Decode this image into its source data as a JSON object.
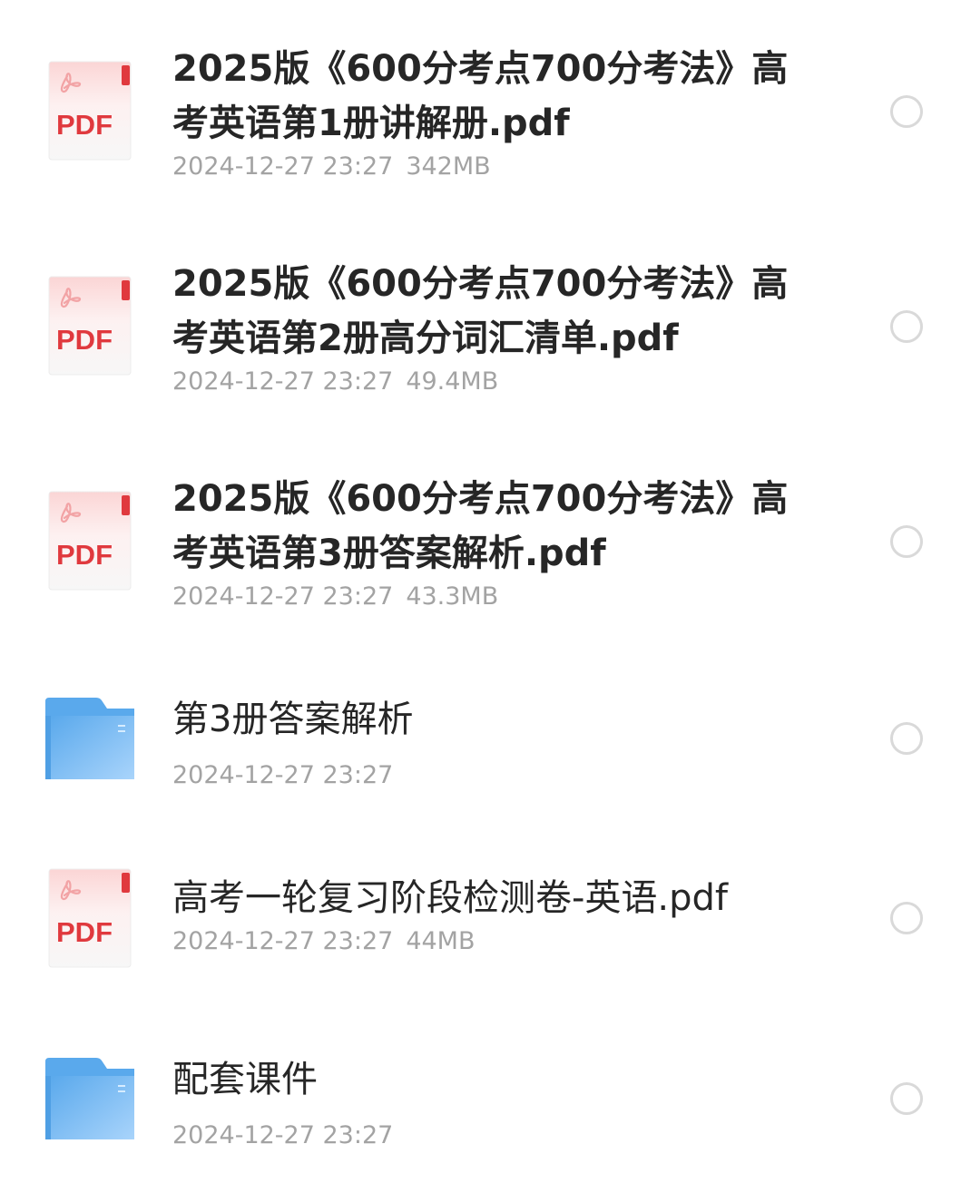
{
  "files": [
    {
      "type": "pdf",
      "icon": "pdf-icon",
      "icon_label": "PDF",
      "name": "2025版《600分考点700分考法》高考英语第1册讲解册.pdf",
      "date": "2024-12-27 23:27",
      "size": "342MB"
    },
    {
      "type": "pdf",
      "icon": "pdf-icon",
      "icon_label": "PDF",
      "name": "2025版《600分考点700分考法》高考英语第2册高分词汇清单.pdf",
      "date": "2024-12-27 23:27",
      "size": "49.4MB"
    },
    {
      "type": "pdf",
      "icon": "pdf-icon",
      "icon_label": "PDF",
      "name": "2025版《600分考点700分考法》高考英语第3册答案解析.pdf",
      "date": "2024-12-27 23:27",
      "size": "43.3MB"
    },
    {
      "type": "folder",
      "icon": "folder-icon",
      "name": "第3册答案解析",
      "date": "2024-12-27 23:27",
      "size": ""
    },
    {
      "type": "pdf",
      "icon": "pdf-icon",
      "icon_label": "PDF",
      "name": "高考一轮复习阶段检测卷-英语.pdf",
      "date": "2024-12-27 23:27",
      "size": "44MB"
    },
    {
      "type": "folder",
      "icon": "folder-icon",
      "name": "配套课件",
      "date": "2024-12-27 23:27",
      "size": ""
    }
  ],
  "colors": {
    "pdf_red": "#e0393e",
    "folder_blue": "#5aa9ec",
    "radio_border": "#d9d9d9",
    "name_text": "#262626",
    "meta_text": "#a3a3a3"
  }
}
